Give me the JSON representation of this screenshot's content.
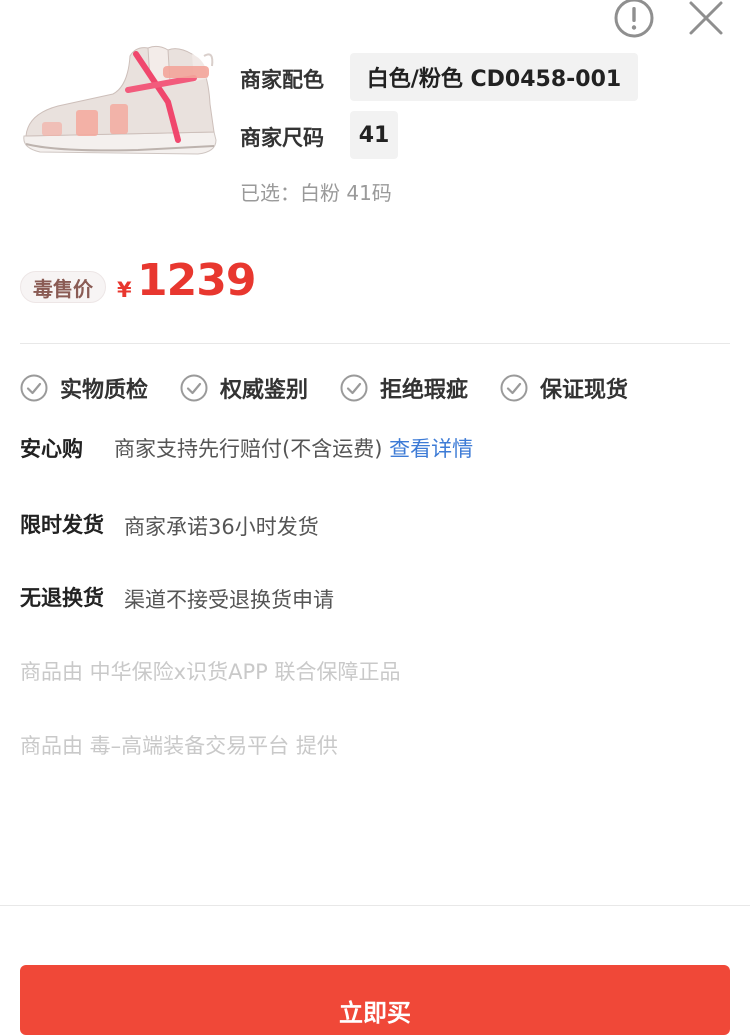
{
  "header": {
    "report_icon": "exclamation-circle-icon",
    "close_icon": "close-icon"
  },
  "product": {
    "image": "sneaker-product-image",
    "color_label": "商家配色",
    "color_value": "白色/粉色 CD0458-001",
    "size_label": "商家尺码",
    "size_value": "41",
    "selected_text": "已选：白粉 41码"
  },
  "price": {
    "tag": "毒售价",
    "currency": "¥",
    "value": "1239",
    "color": "#e8372f"
  },
  "guarantees": [
    {
      "label": "实物质检",
      "icon": "check-circle-icon"
    },
    {
      "label": "权威鉴别",
      "icon": "check-circle-icon"
    },
    {
      "label": "拒绝瑕疵",
      "icon": "check-circle-icon"
    },
    {
      "label": "保证现货",
      "icon": "check-circle-icon"
    }
  ],
  "services": {
    "assurance": {
      "title": "安心购",
      "text": "商家支持先行赔付(不含运费)",
      "link": "查看详情"
    },
    "shipping": {
      "title": "限时发货",
      "text": "商家承诺36小时发货"
    },
    "returns": {
      "title": "无退换货",
      "text": "渠道不接受退换货申请"
    }
  },
  "notes": {
    "insurance": "商品由 中华保险x识货APP 联合保障正品",
    "provider": "商品由 毒–高端装备交易平台 提供"
  },
  "footer": {
    "buy_label": "立即买"
  },
  "colors": {
    "accent": "#f04838",
    "link": "#3d7bd6"
  }
}
